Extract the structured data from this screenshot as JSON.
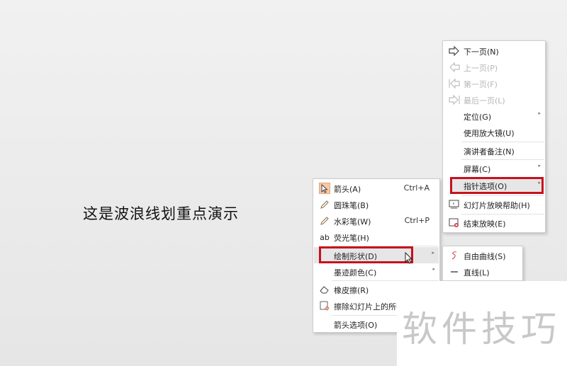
{
  "slide": {
    "text": "这是波浪线划重点演示"
  },
  "main_menu": {
    "items": [
      {
        "label": "下一页(N)",
        "icon": "arrow-right-icon",
        "disabled": false
      },
      {
        "label": "上一页(P)",
        "icon": "arrow-left-icon",
        "disabled": true
      },
      {
        "label": "第一页(F)",
        "icon": "first-page-icon",
        "disabled": true
      },
      {
        "label": "最后一页(L)",
        "icon": "last-page-icon",
        "disabled": true
      },
      {
        "label": "定位(G)",
        "has_submenu": true
      },
      {
        "label": "使用放大镜(U)"
      },
      {
        "label": "演讲者备注(N)"
      },
      {
        "label": "屏幕(C)",
        "has_submenu": true
      },
      {
        "label": "指针选项(O)",
        "has_submenu": true,
        "highlighted": true
      },
      {
        "label": "幻灯片放映帮助(H)",
        "icon": "slideshow-help-icon"
      },
      {
        "label": "结束放映(E)",
        "icon": "end-show-icon"
      }
    ]
  },
  "pointer_menu": {
    "items": [
      {
        "label": "箭头(A)",
        "shortcut": "Ctrl+A",
        "icon": "cursor-arrow-icon",
        "checked": true
      },
      {
        "label": "圆珠笔(B)",
        "icon": "pen-icon"
      },
      {
        "label": "水彩笔(W)",
        "shortcut": "Ctrl+P",
        "icon": "marker-icon"
      },
      {
        "label": "荧光笔(H)",
        "icon": "highlighter-icon"
      },
      {
        "label": "绘制形状(D)",
        "has_submenu": true,
        "highlighted": true
      },
      {
        "label": "墨迹颜色(C)",
        "has_submenu": true
      },
      {
        "label": "橡皮擦(R)",
        "icon": "eraser-icon"
      },
      {
        "label": "擦除幻灯片上的所有",
        "icon": "erase-all-icon"
      },
      {
        "label": "箭头选项(O)"
      }
    ]
  },
  "shape_menu": {
    "items": [
      {
        "label": "自由曲线(S)",
        "icon": "freeform-curve-icon"
      },
      {
        "label": "直线(L)",
        "icon": "line-icon"
      }
    ]
  },
  "watermark": {
    "text": "软件技巧"
  },
  "colors": {
    "highlight_border": "#c8101e",
    "accent_orange": "#e3a77b"
  }
}
